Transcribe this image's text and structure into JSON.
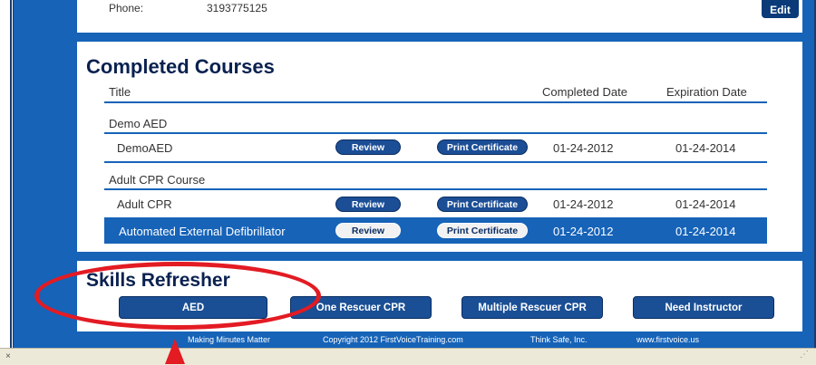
{
  "profile": {
    "phone_label": "Phone:",
    "phone_value": "3193775125",
    "edit_label": "Edit"
  },
  "completed": {
    "title": "Completed Courses",
    "columns": {
      "title": "Title",
      "completed": "Completed Date",
      "expiration": "Expiration Date"
    },
    "groups": [
      {
        "name": "Demo AED",
        "rows": [
          {
            "name": "DemoAED",
            "review": "Review",
            "print": "Print Certificate",
            "completed": "01-24-2012",
            "expiration": "01-24-2014"
          }
        ]
      },
      {
        "name": "Adult CPR Course",
        "rows": [
          {
            "name": "Adult CPR",
            "review": "Review",
            "print": "Print Certificate",
            "completed": "01-24-2012",
            "expiration": "01-24-2014"
          },
          {
            "name": "Automated External Defibrillator",
            "review": "Review",
            "print": "Print Certificate",
            "completed": "01-24-2012",
            "expiration": "01-24-2014"
          }
        ]
      }
    ]
  },
  "skills": {
    "title": "Skills Refresher",
    "buttons": [
      "AED",
      "One Rescuer CPR",
      "Multiple Rescuer CPR",
      "Need Instructor"
    ]
  },
  "footer": {
    "items": [
      "Making Minutes Matter",
      "Copyright 2012 FirstVoiceTraining.com",
      "Think Safe, Inc.",
      "www.firstvoice.us"
    ]
  },
  "status_bar": {
    "close_glyph": "×",
    "resize_glyph": "⋰"
  },
  "colors": {
    "brand_blue": "#1663b8",
    "dark_navy": "#0a2150",
    "annotation_red": "#e31b23"
  }
}
